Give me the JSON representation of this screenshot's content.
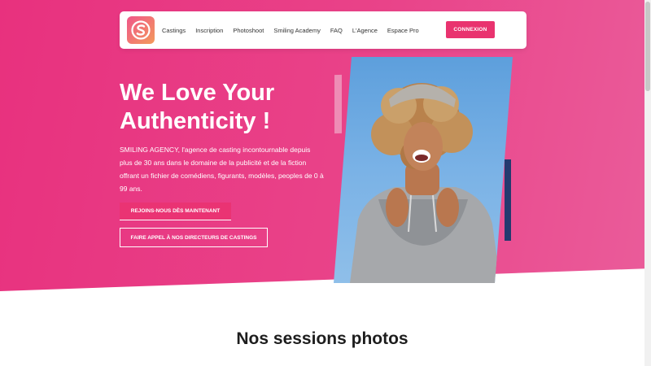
{
  "nav": {
    "links": [
      "Castings",
      "Inscription",
      "Photoshoot",
      "Smiling Academy",
      "FAQ",
      "L'Agence",
      "Espace Pro"
    ],
    "connexion_label": "CONNEXION"
  },
  "hero": {
    "title_line1": "We Love Your",
    "title_line2": "Authenticity !",
    "description": "SMILING AGENCY, l'agence de casting incontournable depuis plus de 30 ans dans le domaine de la publicité et de la fiction offrant un fichier de comédiens, figurants, modèles, peoples de 0 à 99 ans.",
    "primary_button": "REJOINS-NOUS DÈS MAINTENANT",
    "secondary_button": "FAIRE APPEL À NOS DIRECTEURS DE CASTINGS"
  },
  "section": {
    "title": "Nos sessions photos"
  },
  "colors": {
    "brand_pink": "#e9336f",
    "hero_gradient_start": "#e8317e",
    "hero_gradient_end": "#ea5c9a",
    "deco_navy": "#243a6f"
  }
}
